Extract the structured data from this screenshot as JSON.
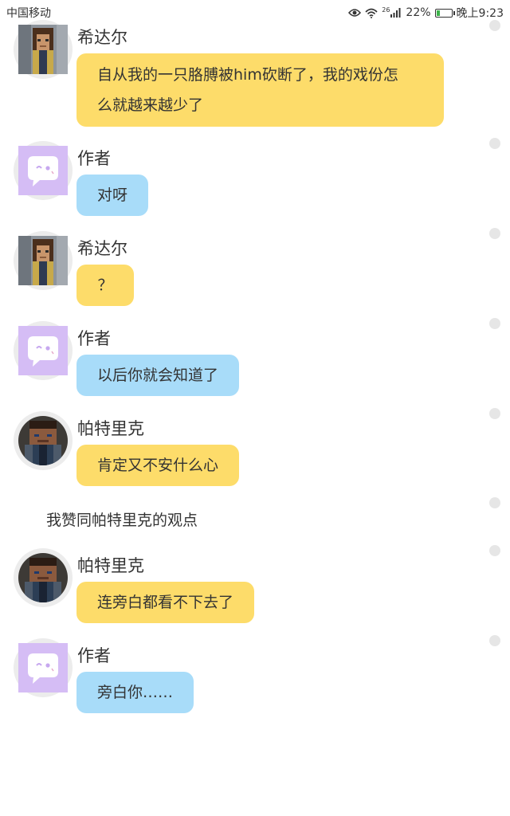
{
  "status_bar": {
    "carrier": "中国移动",
    "network": "26",
    "battery_percent": "22%",
    "time": "晚上9:23",
    "battery_level": 0.22,
    "icons": [
      "eye-icon",
      "wifi-icon",
      "signal-icon",
      "battery-icon"
    ]
  },
  "colors": {
    "yellow_bubble": "#fddc6a",
    "blue_bubble": "#a8dcf9",
    "author_avatar": "#d5bdf5"
  },
  "messages": [
    {
      "speaker": "希达尔",
      "text_line1": "自从我的一只胳膊被him砍断了，我的戏份怎",
      "text_line2": "么就越来越少了"
    },
    {
      "speaker": "作者",
      "text": "对呀"
    },
    {
      "speaker": "希达尔",
      "text": "？"
    },
    {
      "speaker": "作者",
      "text": "以后你就会知道了"
    },
    {
      "speaker": "帕特里克",
      "text": "肯定又不安什么心"
    },
    {
      "narration": "我赞同帕特里克的观点"
    },
    {
      "speaker": "帕特里克",
      "text": "连旁白都看不下去了"
    },
    {
      "speaker": "作者",
      "text": "旁白你……"
    }
  ]
}
